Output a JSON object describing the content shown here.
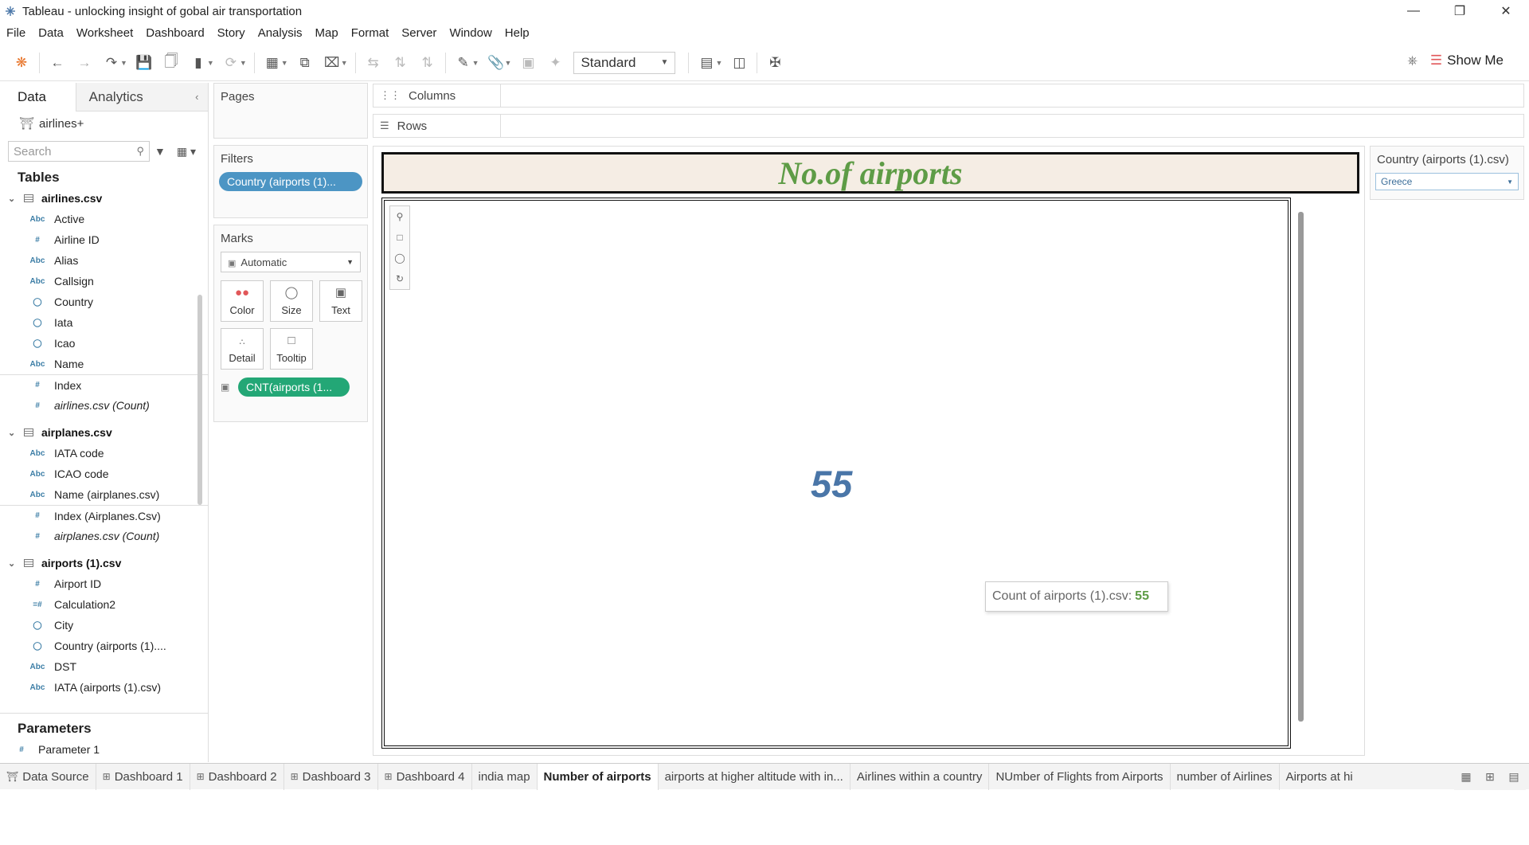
{
  "window": {
    "title": "Tableau - unlocking insight of gobal air transportation"
  },
  "menu": [
    "File",
    "Data",
    "Worksheet",
    "Dashboard",
    "Story",
    "Analysis",
    "Map",
    "Format",
    "Server",
    "Window",
    "Help"
  ],
  "toolbar": {
    "fit_select": "Standard",
    "show_me": "Show Me"
  },
  "data_pane": {
    "tab_data": "Data",
    "tab_analytics": "Analytics",
    "datasource": "airlines+",
    "search_placeholder": "Search",
    "tables_label": "Tables",
    "tables": [
      {
        "name": "airlines.csv",
        "fields": [
          {
            "type": "Abc",
            "name": "Active"
          },
          {
            "type": "#",
            "name": "Airline ID"
          },
          {
            "type": "Abc",
            "name": "Alias"
          },
          {
            "type": "Abc",
            "name": "Callsign"
          },
          {
            "type": "geo",
            "name": "Country"
          },
          {
            "type": "geo",
            "name": "Iata"
          },
          {
            "type": "geo",
            "name": "Icao"
          },
          {
            "type": "Abc",
            "name": "Name"
          },
          {
            "type": "#",
            "name": "Index",
            "sep": true
          },
          {
            "type": "#",
            "name": "airlines.csv (Count)",
            "italic": true
          }
        ]
      },
      {
        "name": "airplanes.csv",
        "fields": [
          {
            "type": "Abc",
            "name": "IATA code"
          },
          {
            "type": "Abc",
            "name": "ICAO code"
          },
          {
            "type": "Abc",
            "name": "Name (airplanes.csv)"
          },
          {
            "type": "#",
            "name": "Index (Airplanes.Csv)",
            "sep": true
          },
          {
            "type": "#",
            "name": "airplanes.csv (Count)",
            "italic": true
          }
        ]
      },
      {
        "name": "airports (1).csv",
        "fields": [
          {
            "type": "#",
            "name": "Airport ID"
          },
          {
            "type": "=#",
            "name": "Calculation2"
          },
          {
            "type": "geo",
            "name": "City"
          },
          {
            "type": "geo",
            "name": "Country (airports (1)...."
          },
          {
            "type": "Abc",
            "name": "DST"
          },
          {
            "type": "Abc",
            "name": "IATA (airports (1).csv)"
          }
        ]
      }
    ],
    "parameters_label": "Parameters",
    "parameters": [
      {
        "type": "#",
        "name": "Parameter 1"
      }
    ]
  },
  "shelves": {
    "pages": "Pages",
    "filters": "Filters",
    "filter_pill": "Country (airports (1)...",
    "marks": "Marks",
    "mark_type": "Automatic",
    "mark_buttons": [
      "Color",
      "Size",
      "Text",
      "Detail",
      "Tooltip"
    ],
    "mark_pill": "CNT(airports (1...",
    "columns": "Columns",
    "rows": "Rows"
  },
  "view": {
    "title": "No.of airports",
    "value": "55",
    "tooltip_label": "Count of airports (1).csv:",
    "tooltip_value": "55"
  },
  "quick_filter": {
    "title": "Country (airports (1).csv)",
    "value": "Greece"
  },
  "sheet_tabs": [
    {
      "label": "Data Source",
      "icon": "db"
    },
    {
      "label": "Dashboard 1",
      "icon": "dash"
    },
    {
      "label": "Dashboard 2",
      "icon": "dash"
    },
    {
      "label": "Dashboard 3",
      "icon": "dash"
    },
    {
      "label": "Dashboard 4",
      "icon": "dash"
    },
    {
      "label": "india map"
    },
    {
      "label": "Number of airports",
      "active": true
    },
    {
      "label": "airports at higher altitude with in..."
    },
    {
      "label": "Airlines within a country"
    },
    {
      "label": "NUmber of Flights from Airports"
    },
    {
      "label": "number of Airlines"
    },
    {
      "label": "Airports at hi"
    }
  ],
  "colors": {
    "title_green": "#5e9c46",
    "value_blue": "#4a76a8",
    "pill_blue": "#4c95c4",
    "pill_green": "#23a776"
  }
}
